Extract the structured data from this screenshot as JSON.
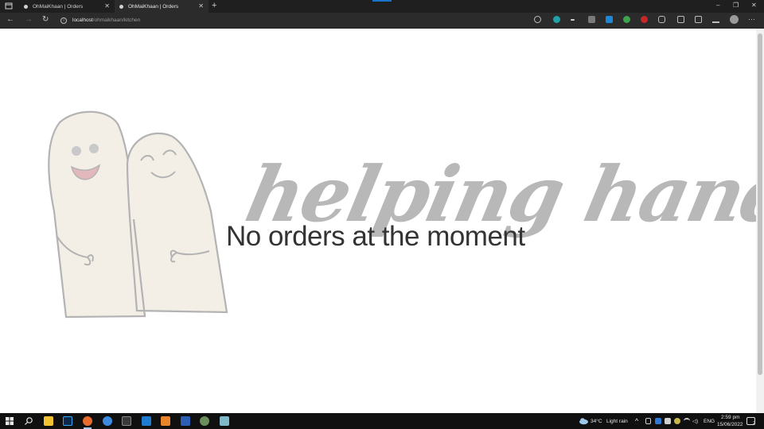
{
  "browser": {
    "tabs": [
      {
        "title": "OhMaiKhaan | Orders",
        "active": false
      },
      {
        "title": "OhMaiKhaan | Orders",
        "active": true
      }
    ],
    "new_tab_icon": "plus-icon",
    "window_controls": {
      "minimize": "–",
      "restore": "❐",
      "close": "✕"
    },
    "nav": {
      "back": "←",
      "forward": "→",
      "reload": "↻"
    },
    "address": {
      "host": "localhost",
      "path": "/ohmaikhaan/kitchen"
    },
    "menu_icon": "···"
  },
  "page": {
    "brand": "helping hand",
    "message": "No orders at the moment",
    "colors": {
      "brand": "#b8b8b8",
      "finger_fill": "#f3efe6",
      "finger_stroke": "#b3b3b3",
      "mouth": "#e2b8bc"
    }
  },
  "taskbar": {
    "weather": {
      "temp": "34°C",
      "condition": "Light rain"
    },
    "language": "ENG",
    "time": "2:59 pm",
    "date": "15/06/2022",
    "notification_count": "2"
  }
}
